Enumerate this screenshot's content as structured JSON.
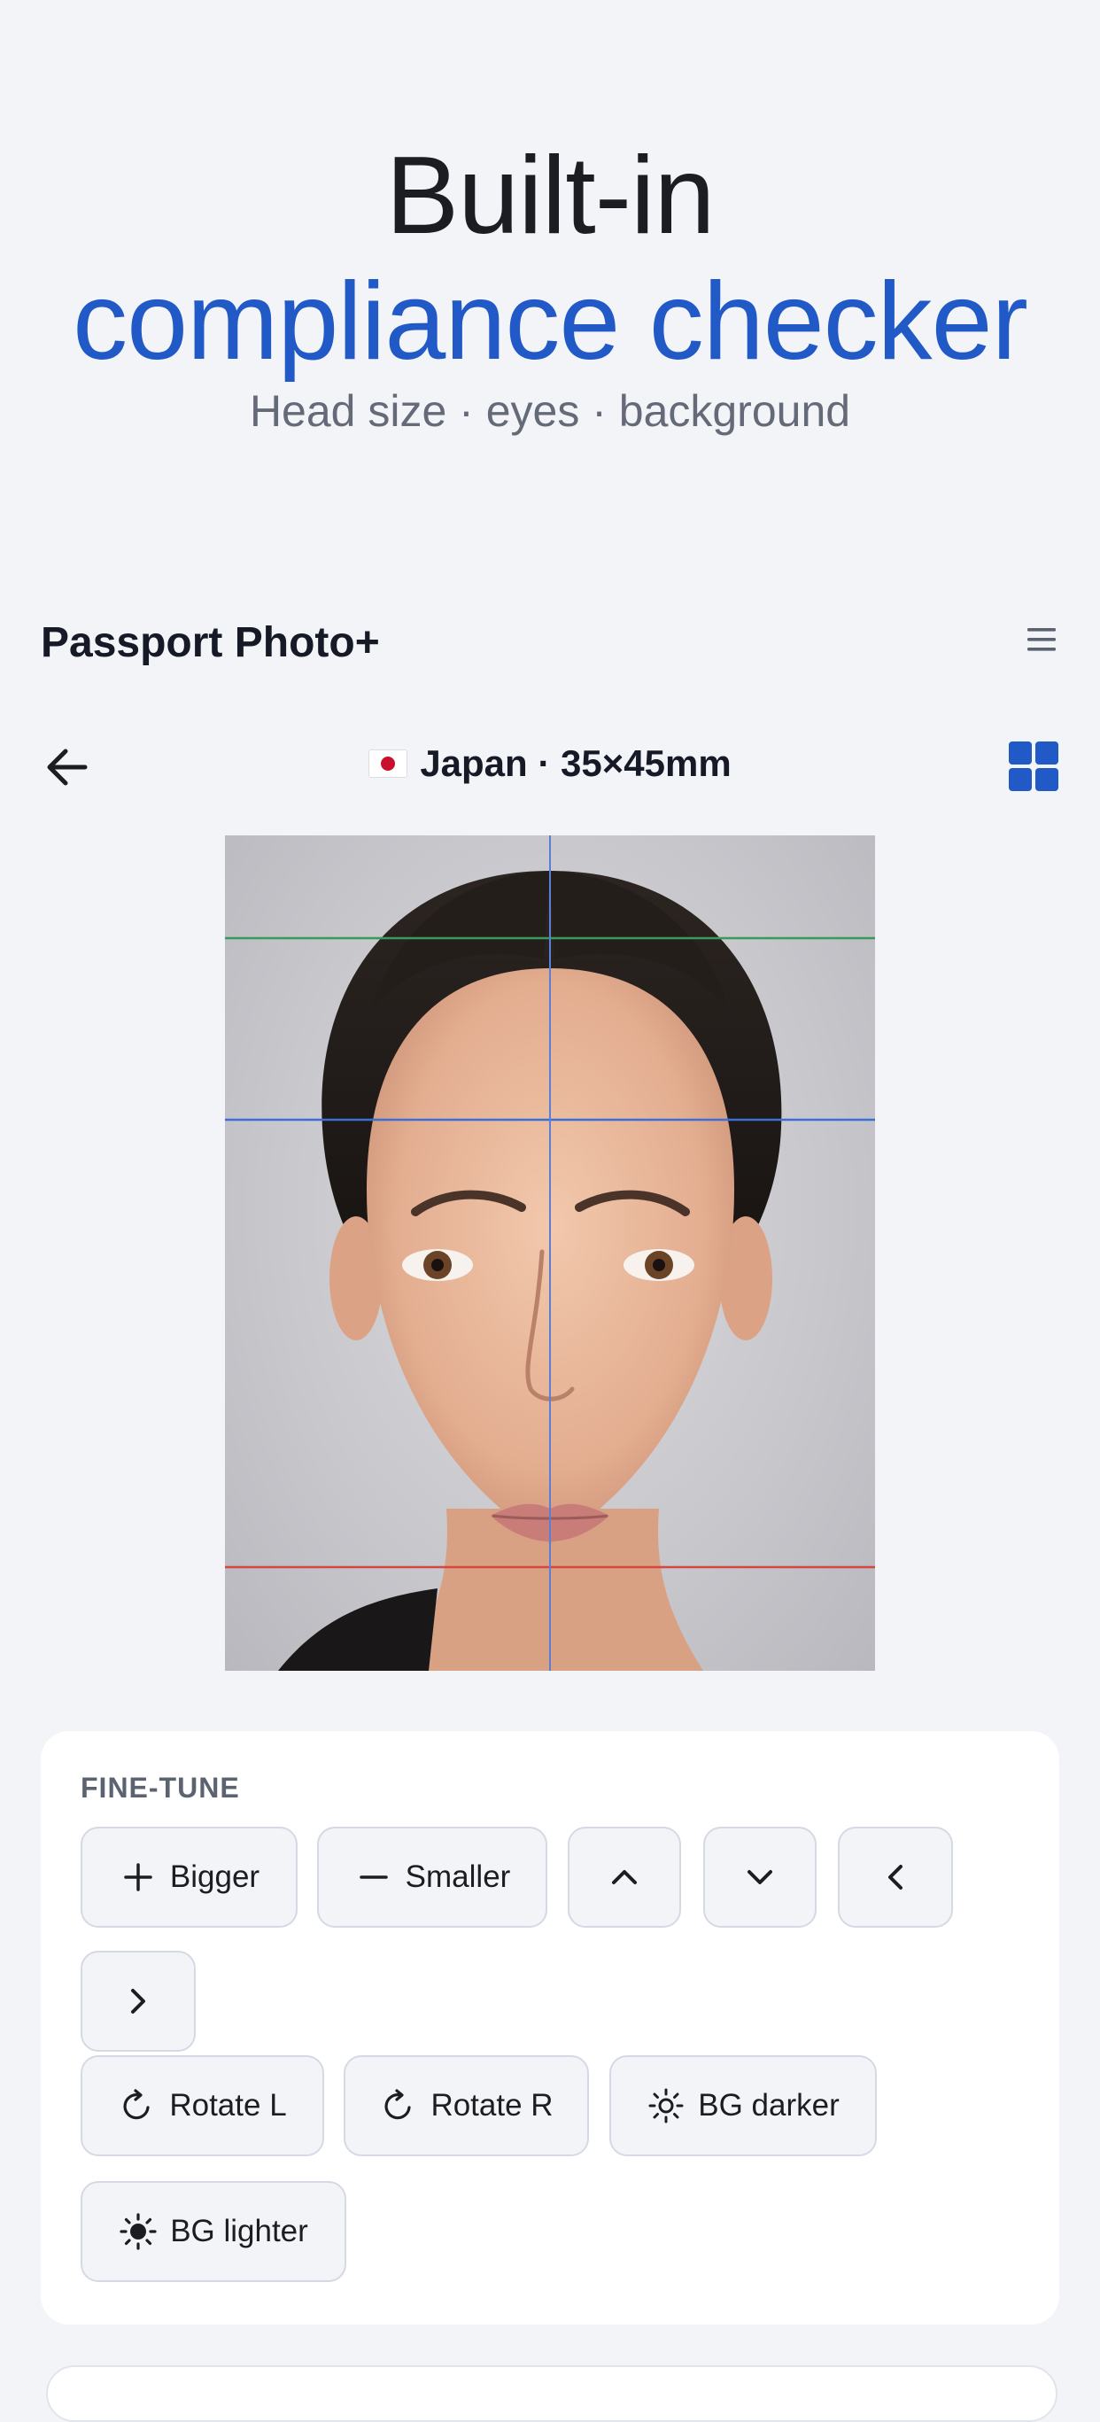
{
  "hero": {
    "line1": "Built-in",
    "line2": "compliance checker",
    "subtitle": "Head size · eyes · background"
  },
  "app": {
    "title": "Passport Photo+",
    "menu_icon": "hamburger-icon"
  },
  "nav": {
    "back_icon": "arrow-left-icon",
    "flag_icon": "japan-flag-icon",
    "title": "Japan · 35×45mm",
    "grid_icon": "grid-icon"
  },
  "photo": {
    "description_icon": "portrait-photo",
    "guides": [
      "top-of-head-line",
      "eye-line",
      "chin-line",
      "center-line"
    ]
  },
  "fine_tune": {
    "label": "FINE-TUNE",
    "buttons": [
      {
        "label": "Bigger",
        "icon": "plus-icon"
      },
      {
        "label": "Smaller",
        "icon": "minus-icon"
      },
      {
        "label": "",
        "icon": "chevron-up-icon"
      },
      {
        "label": "",
        "icon": "chevron-down-icon"
      },
      {
        "label": "",
        "icon": "chevron-left-icon"
      },
      {
        "label": "",
        "icon": "chevron-right-icon"
      },
      {
        "label": "Rotate L",
        "icon": "rotate-icon"
      },
      {
        "label": "Rotate R",
        "icon": "rotate-icon"
      },
      {
        "label": "BG darker",
        "icon": "sun-outline-icon"
      },
      {
        "label": "BG lighter",
        "icon": "sun-filled-icon"
      }
    ]
  },
  "colors": {
    "accent": "#2159c7",
    "background": "#f3f4f8",
    "guide_top": "#3a9a5a",
    "guide_eye": "#3b6fd8",
    "guide_chin": "#d4463e"
  }
}
